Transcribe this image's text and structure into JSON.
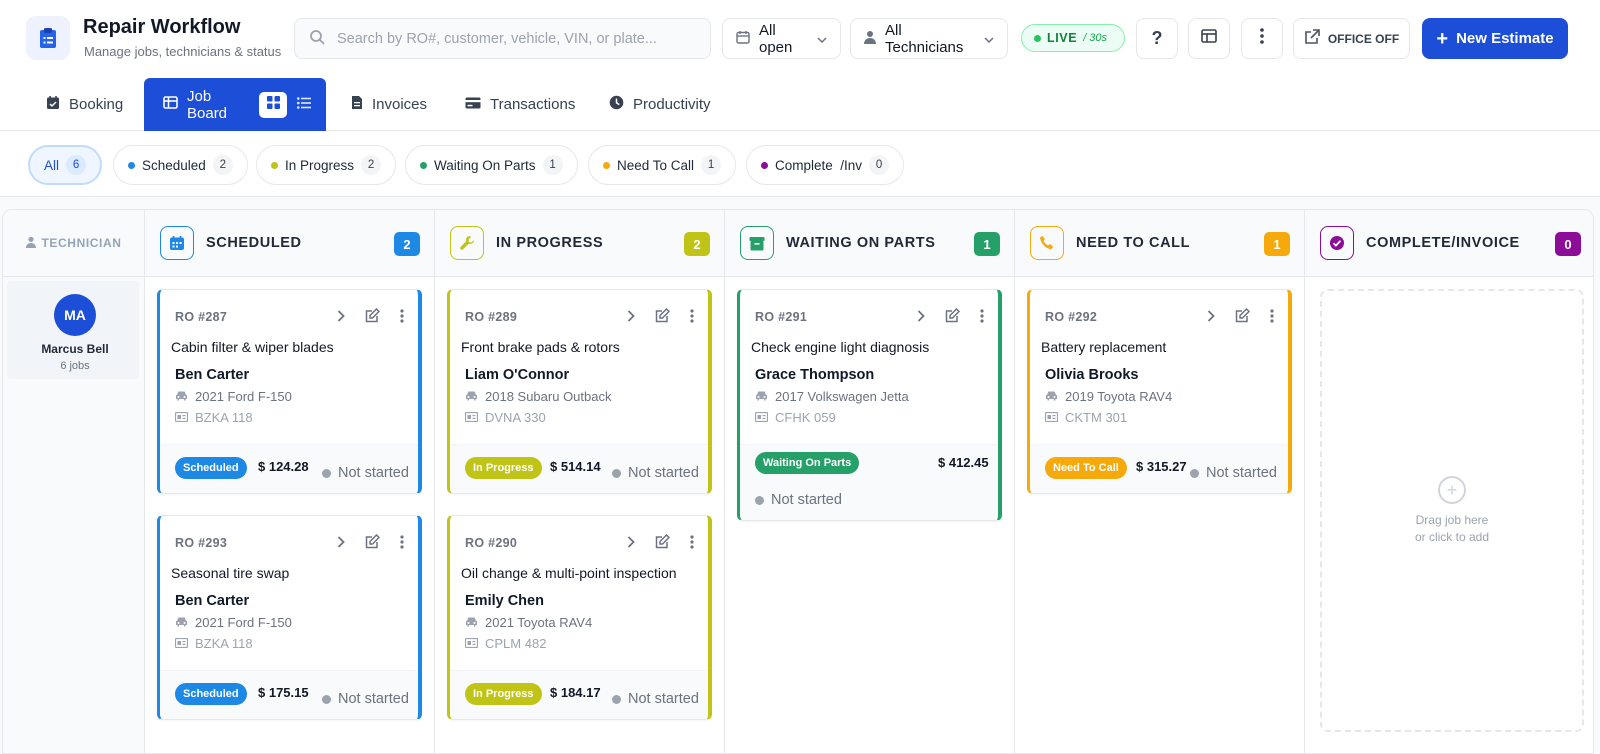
{
  "app": {
    "title": "Repair Workflow",
    "subtitle": "Manage jobs, technicians & status"
  },
  "search": {
    "placeholder": "Search by RO#, customer, vehicle, VIN, or plate..."
  },
  "filters_top": {
    "status": "All open",
    "technician": "All Technicians"
  },
  "live": {
    "label": "LIVE",
    "interval": "/ 30s"
  },
  "office": {
    "label": "OFFICE OFF"
  },
  "new_estimate": {
    "label": "New Estimate"
  },
  "nav": {
    "tabs": [
      {
        "label": "Booking"
      },
      {
        "label": "Job Board"
      },
      {
        "label": "Invoices"
      },
      {
        "label": "Transactions"
      },
      {
        "label": "Productivity"
      }
    ]
  },
  "status_chips": [
    {
      "label": "All",
      "count": "6"
    },
    {
      "label": "Scheduled",
      "count": "2",
      "color": "#1e88e5"
    },
    {
      "label": "In Progress",
      "count": "2",
      "color": "#c0c417"
    },
    {
      "label": "Waiting On Parts",
      "count": "1",
      "color": "#26a069"
    },
    {
      "label": "Need To Call",
      "count": "1",
      "color": "#f5a90a"
    },
    {
      "label": "Complete  /Inv",
      "count": "0",
      "color": "#8b0d98"
    }
  ],
  "board": {
    "tech_header": "TECHNICIAN",
    "technician": {
      "initials": "MA",
      "name": "Marcus Bell",
      "jobs": "6 jobs"
    },
    "columns": [
      {
        "title": "SCHEDULED",
        "count": "2",
        "color": "#1e88e5"
      },
      {
        "title": "IN PROGRESS",
        "count": "2",
        "color": "#c0c417"
      },
      {
        "title": "WAITING ON PARTS",
        "count": "1",
        "color": "#26a069"
      },
      {
        "title": "NEED TO CALL",
        "count": "1",
        "color": "#f5a90a"
      },
      {
        "title": "COMPLETE/INVOICE",
        "count": "0",
        "color": "#8b0d98"
      }
    ],
    "dropzone": {
      "line1": "Drag job here",
      "line2": "or click to add"
    }
  },
  "cards": [
    {
      "ro": "RO #287",
      "service": "Cabin filter & wiper blades",
      "customer": "Ben Carter",
      "vehicle": "2021 Ford F-150",
      "plate": "BZKA 118",
      "status": "Scheduled",
      "amount": "$ 124.28",
      "progress": "Not started"
    },
    {
      "ro": "RO #293",
      "service": "Seasonal tire swap",
      "customer": "Ben Carter",
      "vehicle": "2021 Ford F-150",
      "plate": "BZKA 118",
      "status": "Scheduled",
      "amount": "$ 175.15",
      "progress": "Not started"
    },
    {
      "ro": "RO #289",
      "service": "Front brake pads & rotors",
      "customer": "Liam O'Connor",
      "vehicle": "2018 Subaru Outback",
      "plate": "DVNA 330",
      "status": "In Progress",
      "amount": "$ 514.14",
      "progress": "Not started"
    },
    {
      "ro": "RO #290",
      "service": "Oil change & multi-point inspection",
      "customer": "Emily Chen",
      "vehicle": "2021 Toyota RAV4",
      "plate": "CPLM 482",
      "status": "In Progress",
      "amount": "$ 184.17",
      "progress": "Not started"
    },
    {
      "ro": "RO #291",
      "service": "Check engine light diagnosis",
      "customer": "Grace Thompson",
      "vehicle": "2017 Volkswagen Jetta",
      "plate": "CFHK 059",
      "status": "Waiting On Parts",
      "amount": "$ 412.45",
      "progress": "Not started"
    },
    {
      "ro": "RO #292",
      "service": "Battery replacement",
      "customer": "Olivia Brooks",
      "vehicle": "2019 Toyota RAV4",
      "plate": "CKTM 301",
      "status": "Need To Call",
      "amount": "$ 315.27",
      "progress": "Not started"
    }
  ]
}
